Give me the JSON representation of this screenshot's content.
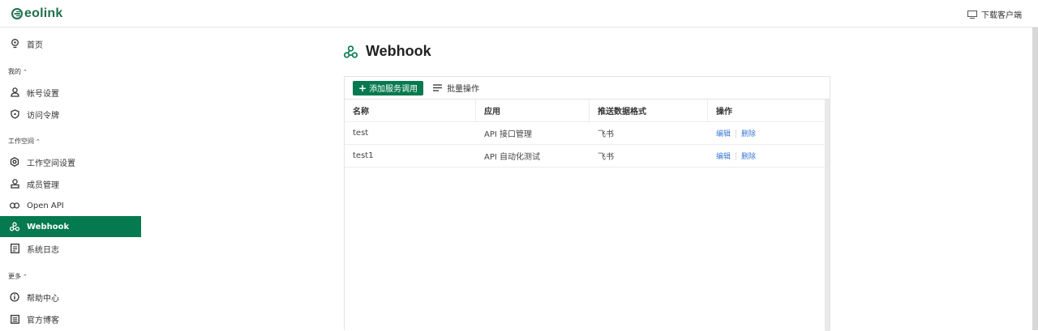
{
  "brand": {
    "logo_text": "eolink",
    "accent": "#05794f"
  },
  "header": {
    "download_label": "下载客户端",
    "download_icon": "monitor-icon"
  },
  "sidebar": {
    "home": {
      "label": "首页",
      "icon": "lightbulb-icon"
    },
    "groups": [
      {
        "label": "我的",
        "items": [
          {
            "label": "帐号设置",
            "icon": "user-icon"
          },
          {
            "label": "访问令牌",
            "icon": "shield-icon"
          }
        ]
      },
      {
        "label": "工作空间",
        "items": [
          {
            "label": "工作空间设置",
            "icon": "gear-icon"
          },
          {
            "label": "成员管理",
            "icon": "member-icon"
          },
          {
            "label": "Open API",
            "icon": "link-icon"
          },
          {
            "label": "Webhook",
            "icon": "webhook-icon",
            "active": true
          },
          {
            "label": "系统日志",
            "icon": "log-icon"
          }
        ]
      },
      {
        "label": "更多",
        "items": [
          {
            "label": "帮助中心",
            "icon": "info-icon"
          },
          {
            "label": "官方博客",
            "icon": "doc-icon"
          }
        ]
      }
    ]
  },
  "main": {
    "title": "Webhook",
    "toolbar": {
      "add_label": "添加服务调用",
      "batch_label": "批量操作"
    },
    "table": {
      "columns": [
        "名称",
        "应用",
        "推送数据格式",
        "操作"
      ],
      "rows": [
        {
          "name": "test",
          "app": "API 接口管理",
          "format": "飞书",
          "edit": "编辑",
          "delete": "删除"
        },
        {
          "name": "test1",
          "app": "API 自动化测试",
          "format": "飞书",
          "edit": "编辑",
          "delete": "删除"
        }
      ]
    }
  }
}
